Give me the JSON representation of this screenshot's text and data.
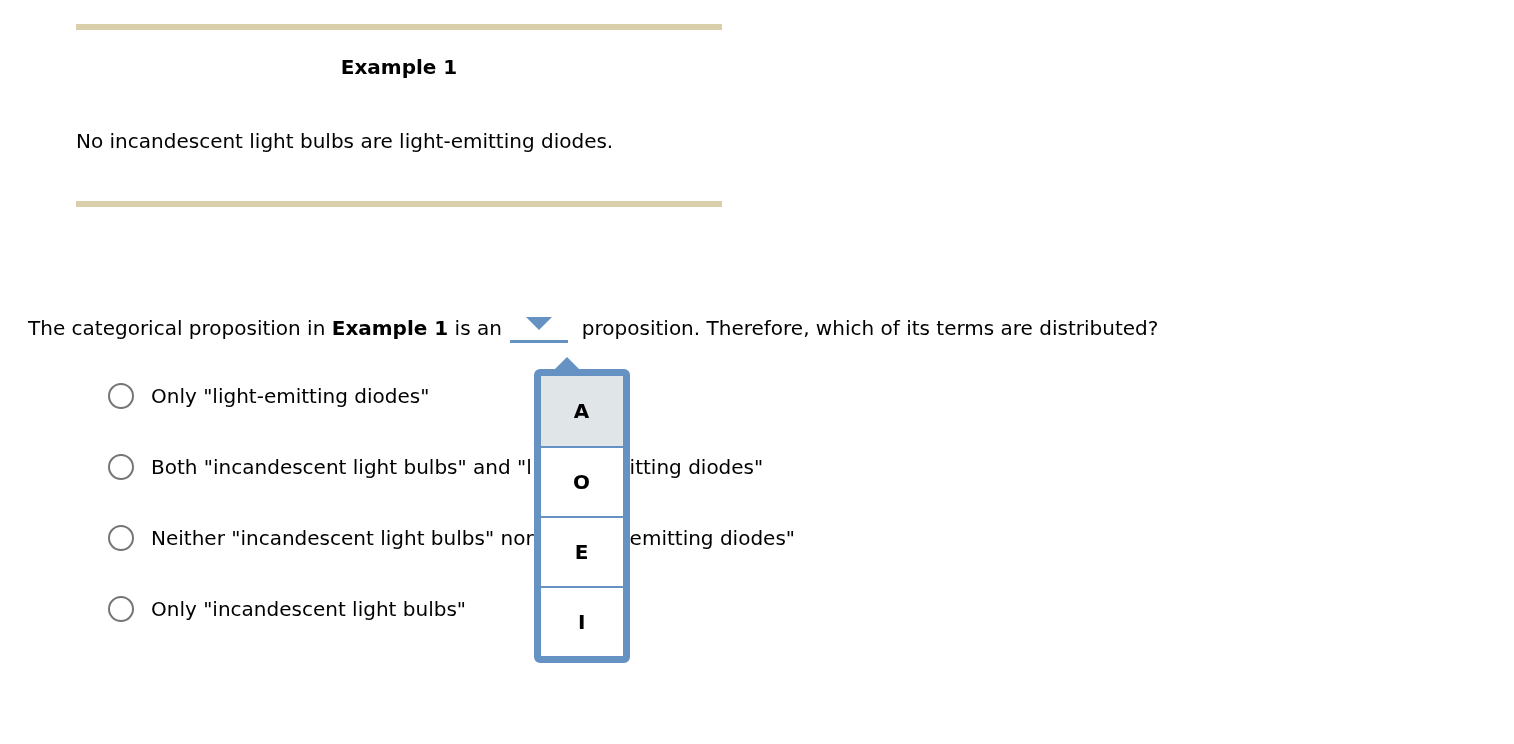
{
  "example": {
    "title": "Example 1",
    "statement": "No incandescent light bulbs are light-emitting diodes."
  },
  "question": {
    "before": "The categorical proposition in **Example 1** is an",
    "dropdown": {
      "expanded": true
    },
    "after": "proposition. Therefore, which of its terms are distributed?"
  },
  "menu": [
    {
      "label": "A",
      "selected": true
    },
    {
      "label": "O",
      "selected": false
    },
    {
      "label": "E",
      "selected": false
    },
    {
      "label": "I",
      "selected": false
    }
  ],
  "options": [
    {
      "text": "Only \"light-emitting diodes\"",
      "selected": false
    },
    {
      "text": "Both \"incandescent light bulbs\" and \"l",
      "text_after": "itting diodes\"",
      "selected": false
    },
    {
      "text": "Neither \"incandescent light bulbs\" nor",
      "text_after": "emitting diodes\"",
      "selected": false
    },
    {
      "text": "Only \"incandescent light bulbs\"",
      "selected": false
    }
  ]
}
